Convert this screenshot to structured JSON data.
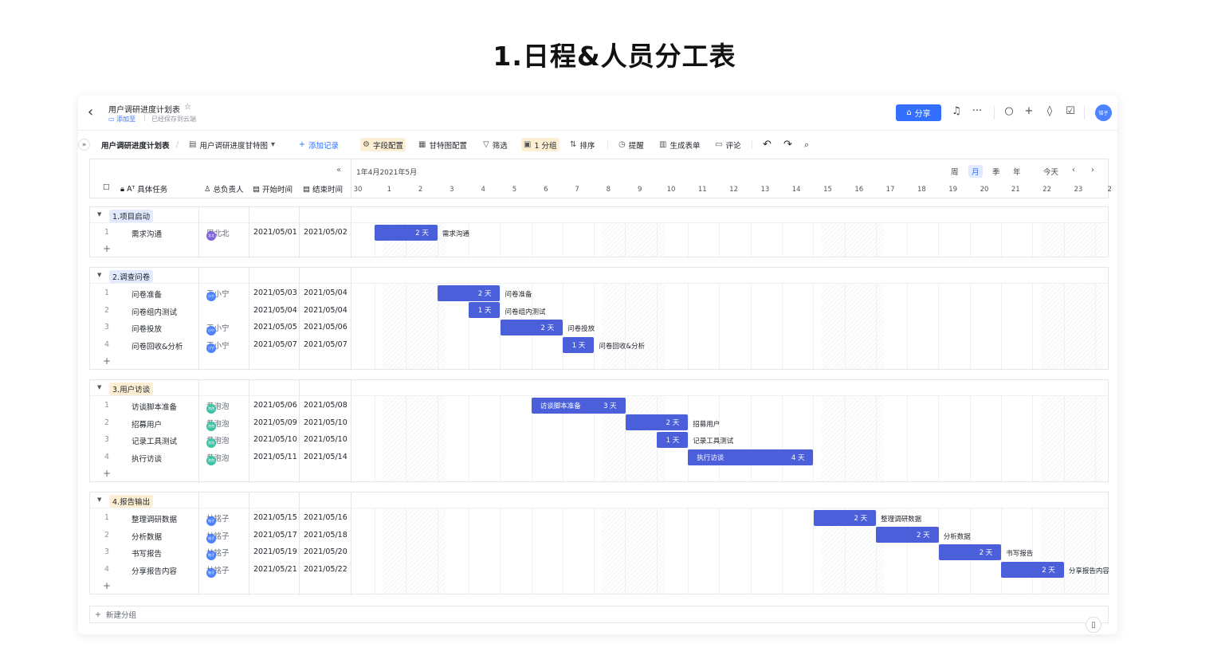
{
  "page_title": "1.日程&人员分工表",
  "header": {
    "doc_title": "用户调研进度计划表",
    "add_to": "添加至",
    "saved": "已经保存到云端",
    "share_label": "分享",
    "avatar": "铭子"
  },
  "toolbar": {
    "table_name": "用户调研进度计划表",
    "view_name": "用户调研进度甘特图",
    "add_record": "添加记录",
    "field_config": "字段配置",
    "gantt_config": "甘特图配置",
    "filter": "筛选",
    "group": "1 分组",
    "sort": "排序",
    "remind": "提醒",
    "form": "生成表单",
    "comment": "评论"
  },
  "columns": {
    "task": "具体任务",
    "owner": "总负责人",
    "start": "开始时间",
    "end": "结束时间"
  },
  "timeline": {
    "month_label": "1年4月2021年5月",
    "views": [
      "周",
      "月",
      "季",
      "年"
    ],
    "today": "今天",
    "days": [
      "30",
      "1",
      "2",
      "3",
      "4",
      "5",
      "6",
      "7",
      "8",
      "9",
      "10",
      "11",
      "12",
      "13",
      "14",
      "15",
      "16",
      "17",
      "18",
      "19",
      "20",
      "21",
      "22",
      "23",
      "2"
    ]
  },
  "groups": [
    {
      "name": "1.项目启动",
      "tag_color": "#e1eaff",
      "rows": [
        {
          "num": "1",
          "task": "需求沟通",
          "owner": "周北北",
          "owner_short": "北北",
          "owner_color": "#7f63d9",
          "start": "2021/05/01",
          "end": "2021/05/02",
          "bar_label": "2 天",
          "bar_text": "需求沟通"
        }
      ]
    },
    {
      "name": "2.调查问卷",
      "tag_color": "#e1eaff",
      "rows": [
        {
          "num": "1",
          "task": "问卷准备",
          "owner": "于小宁",
          "owner_short": "小宁",
          "owner_color": "#4e83fd",
          "start": "2021/05/03",
          "end": "2021/05/04",
          "bar_label": "2 天",
          "bar_text": "问卷准备"
        },
        {
          "num": "2",
          "task": "问卷组内测试",
          "owner": "",
          "owner_short": "",
          "owner_color": "",
          "start": "2021/05/04",
          "end": "2021/05/04",
          "bar_label": "1 天",
          "bar_text": "问卷组内测试"
        },
        {
          "num": "3",
          "task": "问卷投放",
          "owner": "于小宁",
          "owner_short": "小宁",
          "owner_color": "#4e83fd",
          "start": "2021/05/05",
          "end": "2021/05/06",
          "bar_label": "2 天",
          "bar_text": "问卷投放"
        },
        {
          "num": "4",
          "task": "问卷回收&分析",
          "owner": "于小宁",
          "owner_short": "小宁",
          "owner_color": "#4e83fd",
          "start": "2021/05/07",
          "end": "2021/05/07",
          "bar_label": "1 天",
          "bar_text": "问卷回收&分析"
        }
      ]
    },
    {
      "name": "3.用户访谈",
      "tag_color": "#fcefd3",
      "rows": [
        {
          "num": "1",
          "task": "访谈脚本准备",
          "owner": "黄泡泡",
          "owner_short": "泡泡",
          "owner_color": "#3ec3a4",
          "start": "2021/05/06",
          "end": "2021/05/08",
          "bar_label": "3 天",
          "bar_inner": "访谈脚本准备"
        },
        {
          "num": "2",
          "task": "招募用户",
          "owner": "黄泡泡",
          "owner_short": "泡泡",
          "owner_color": "#3ec3a4",
          "start": "2021/05/09",
          "end": "2021/05/10",
          "bar_label": "2 天",
          "bar_text": "招募用户"
        },
        {
          "num": "3",
          "task": "记录工具测试",
          "owner": "黄泡泡",
          "owner_short": "泡泡",
          "owner_color": "#3ec3a4",
          "start": "2021/05/10",
          "end": "2021/05/10",
          "bar_label": "1 天",
          "bar_text": "记录工具测试"
        },
        {
          "num": "4",
          "task": "执行访谈",
          "owner": "黄泡泡",
          "owner_short": "泡泡",
          "owner_color": "#3ec3a4",
          "start": "2021/05/11",
          "end": "2021/05/14",
          "bar_label": "4 天",
          "bar_inner": "执行访谈"
        }
      ]
    },
    {
      "name": "4.报告输出",
      "tag_color": "#fcefd3",
      "rows": [
        {
          "num": "1",
          "task": "整理调研数据",
          "owner": "林铭子",
          "owner_short": "铭子",
          "owner_color": "#4e83fd",
          "start": "2021/05/15",
          "end": "2021/05/16",
          "bar_label": "2 天",
          "bar_text": "整理调研数据"
        },
        {
          "num": "2",
          "task": "分析数据",
          "owner": "林铭子",
          "owner_short": "铭子",
          "owner_color": "#4e83fd",
          "start": "2021/05/17",
          "end": "2021/05/18",
          "bar_label": "2 天",
          "bar_text": "分析数据"
        },
        {
          "num": "3",
          "task": "书写报告",
          "owner": "林铭子",
          "owner_short": "铭子",
          "owner_color": "#4e83fd",
          "start": "2021/05/19",
          "end": "2021/05/20",
          "bar_label": "2 天",
          "bar_text": "书写报告"
        },
        {
          "num": "4",
          "task": "分享报告内容",
          "owner": "林铭子",
          "owner_short": "铭子",
          "owner_color": "#4e83fd",
          "start": "2021/05/21",
          "end": "2021/05/22",
          "bar_label": "2 天",
          "bar_text": "分享报告内容"
        }
      ]
    }
  ],
  "new_group": "新建分组"
}
